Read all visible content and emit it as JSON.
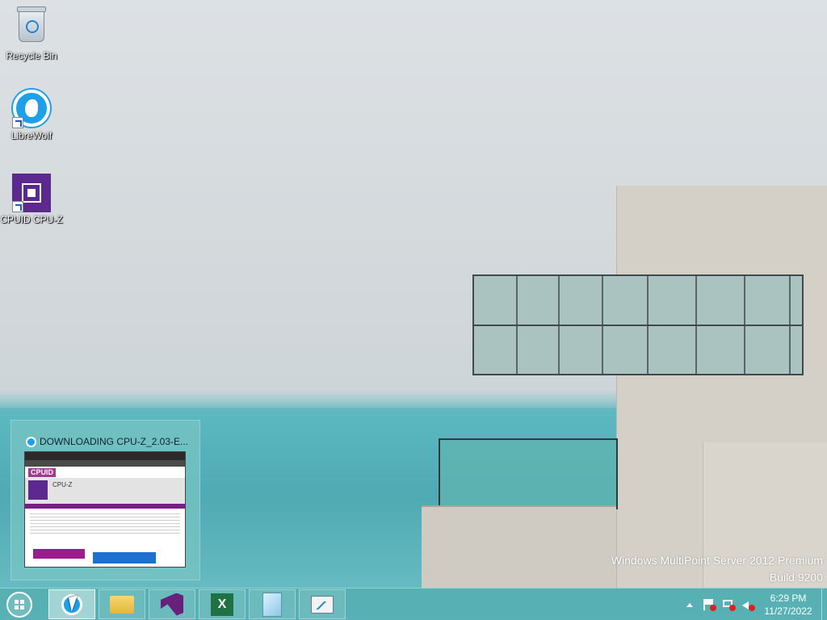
{
  "desktop": {
    "icons": [
      {
        "label": "Recycle Bin",
        "icon": "recycle-bin-icon"
      },
      {
        "label": "LibreWolf",
        "icon": "librewolf-icon"
      },
      {
        "label": "CPUID CPU-Z",
        "icon": "cpu-z-icon"
      }
    ],
    "watermark": {
      "line1": "Windows MultiPoint Server 2012 Premium",
      "line2": "Build 9200"
    }
  },
  "preview": {
    "title": "DOWNLOADING CPU-Z_2.03-E...",
    "thumb_logo": "CPUID",
    "thumb_heading": "CPU-Z"
  },
  "taskbar": {
    "buttons": [
      {
        "name": "LibreWolf",
        "icon": "librewolf-icon",
        "active": true
      },
      {
        "name": "File Explorer",
        "icon": "folder-icon",
        "active": false
      },
      {
        "name": "Visual Studio",
        "icon": "visual-studio-icon",
        "active": false
      },
      {
        "name": "Excel",
        "icon": "excel-icon",
        "glyph": "X",
        "active": false
      },
      {
        "name": "Notepad",
        "icon": "notepad-icon",
        "active": false
      },
      {
        "name": "Performance Monitor",
        "icon": "monitor-icon",
        "active": false
      }
    ],
    "clock": {
      "time": "6:29 PM",
      "date": "11/27/2022"
    }
  },
  "colors": {
    "taskbar": "#56b0b2",
    "accent_blue": "#1ea0e8",
    "cpuz_purple": "#5c2a8e"
  }
}
